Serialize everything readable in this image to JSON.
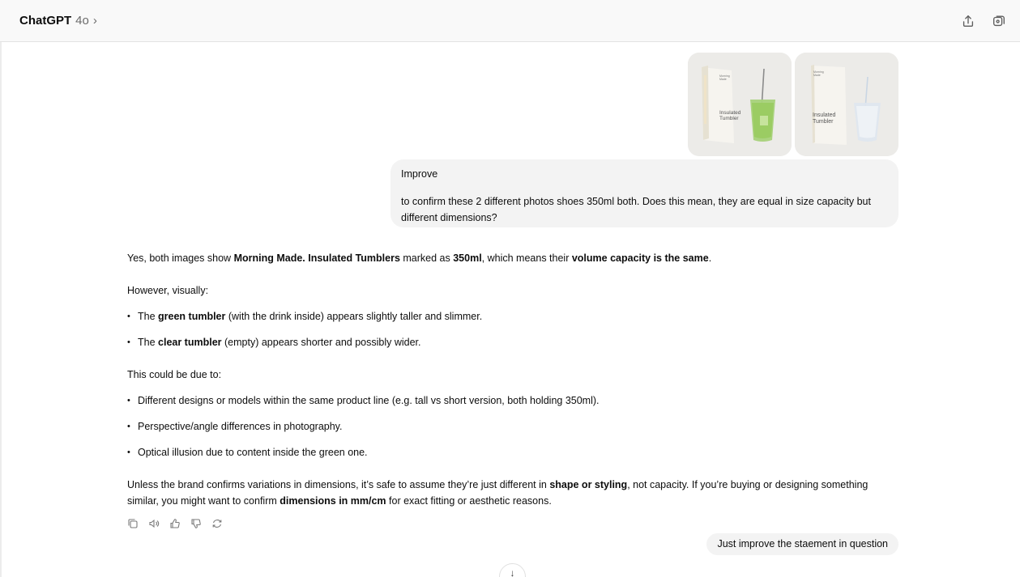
{
  "header": {
    "app_name": "ChatGPT",
    "model": "4o",
    "chevron": "›",
    "icons": [
      "share-icon",
      "new-chat-icon"
    ]
  },
  "user_message_1": {
    "attachments": [
      {
        "name": "product-photo-green",
        "box_title": "Insulated Tumbler",
        "box_brand": "Morning Made"
      },
      {
        "name": "product-photo-clear",
        "box_title": "Insulated Tumbler",
        "box_brand": "Morning Made"
      }
    ],
    "line1": "Improve",
    "line2": "to confirm these 2 different photos shoes 350ml both. Does this mean, they are equal in size capacity but different dimensions?"
  },
  "assistant_message": {
    "p1": {
      "t1": "Yes, both images show ",
      "b1": "Morning Made. Insulated Tumblers",
      "t2": " marked as ",
      "b2": "350ml",
      "t3": ", which means their ",
      "b3": "volume capacity is the same",
      "t4": "."
    },
    "p2": "However, visually:",
    "bullets1": [
      {
        "t1": "The ",
        "b": "green tumbler",
        "t2": " (with the drink inside) appears slightly taller and slimmer."
      },
      {
        "t1": "The ",
        "b": "clear tumbler",
        "t2": " (empty) appears shorter and possibly wider."
      }
    ],
    "p3": "This could be due to:",
    "bullets2": [
      "Different designs or models within the same product line (e.g. tall vs short version, both holding 350ml).",
      "Perspective/angle differences in photography.",
      "Optical illusion due to content inside the green one."
    ],
    "p4": {
      "t1": "Unless the brand confirms variations in dimensions, it’s safe to assume they’re just different in ",
      "b1": "shape or styling",
      "t2": ", not capacity. If you’re buying or designing something similar, you might want to confirm ",
      "b2": "dimensions in mm/cm",
      "t3": " for exact fitting or aesthetic reasons."
    },
    "actions": [
      "copy-icon",
      "read-aloud-icon",
      "thumbs-up-icon",
      "thumbs-down-icon",
      "regenerate-icon"
    ]
  },
  "user_message_2": {
    "text": "Just improve the staement in question"
  },
  "scroll_button": {
    "glyph": "↓"
  }
}
